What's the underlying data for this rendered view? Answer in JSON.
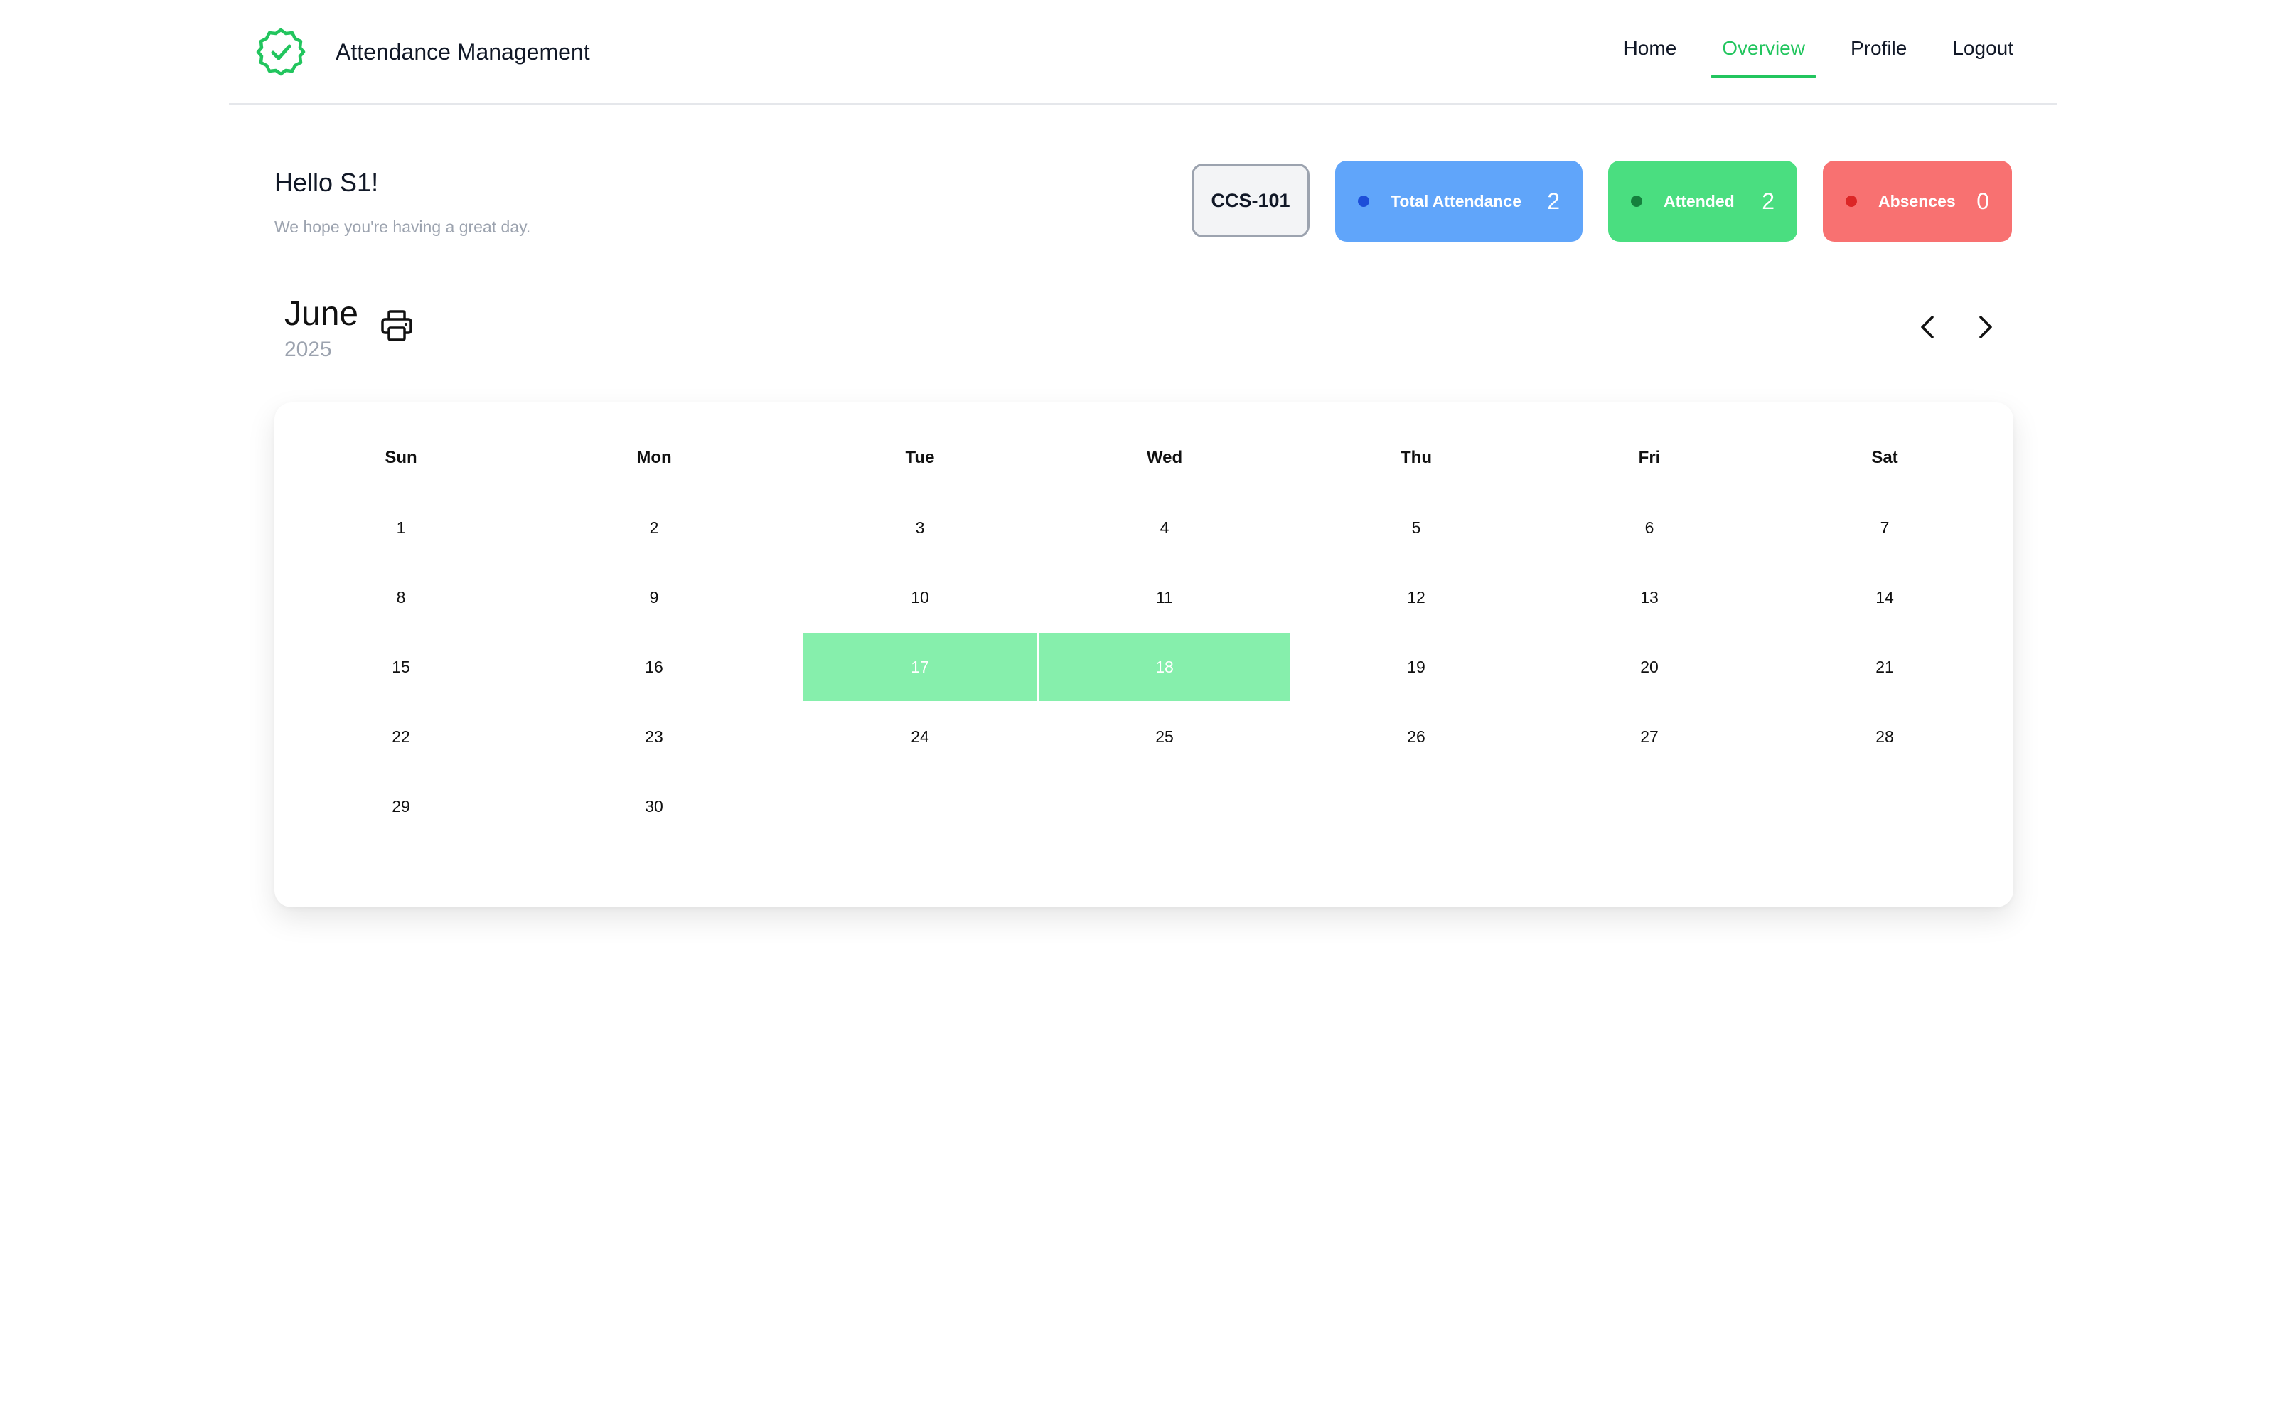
{
  "app": {
    "title": "Attendance Management",
    "accent_color": "#22c55e"
  },
  "nav": {
    "items": [
      {
        "label": "Home",
        "active": false
      },
      {
        "label": "Overview",
        "active": true
      },
      {
        "label": "Profile",
        "active": false
      },
      {
        "label": "Logout",
        "active": false
      }
    ]
  },
  "greeting": {
    "title": "Hello S1!",
    "subtitle": "We hope you're having a great day."
  },
  "course": {
    "code": "CCS-101"
  },
  "stats": {
    "total": {
      "label": "Total Attendance",
      "value": "2",
      "color": "#60a5fa"
    },
    "attended": {
      "label": "Attended",
      "value": "2",
      "color": "#4ade80"
    },
    "absences": {
      "label": "Absences",
      "value": "0",
      "color": "#f87171"
    }
  },
  "calendar": {
    "month": "June",
    "year": "2025",
    "weekdays": [
      "Sun",
      "Mon",
      "Tue",
      "Wed",
      "Thu",
      "Fri",
      "Sat"
    ],
    "first_weekday_index": 0,
    "days_in_month": 30,
    "present_days": [
      17,
      18
    ],
    "present_color": "#86efac"
  },
  "icons": {
    "logo": "verified-badge-icon",
    "print": "printer-icon",
    "prev": "chevron-left-icon",
    "next": "chevron-right-icon"
  }
}
